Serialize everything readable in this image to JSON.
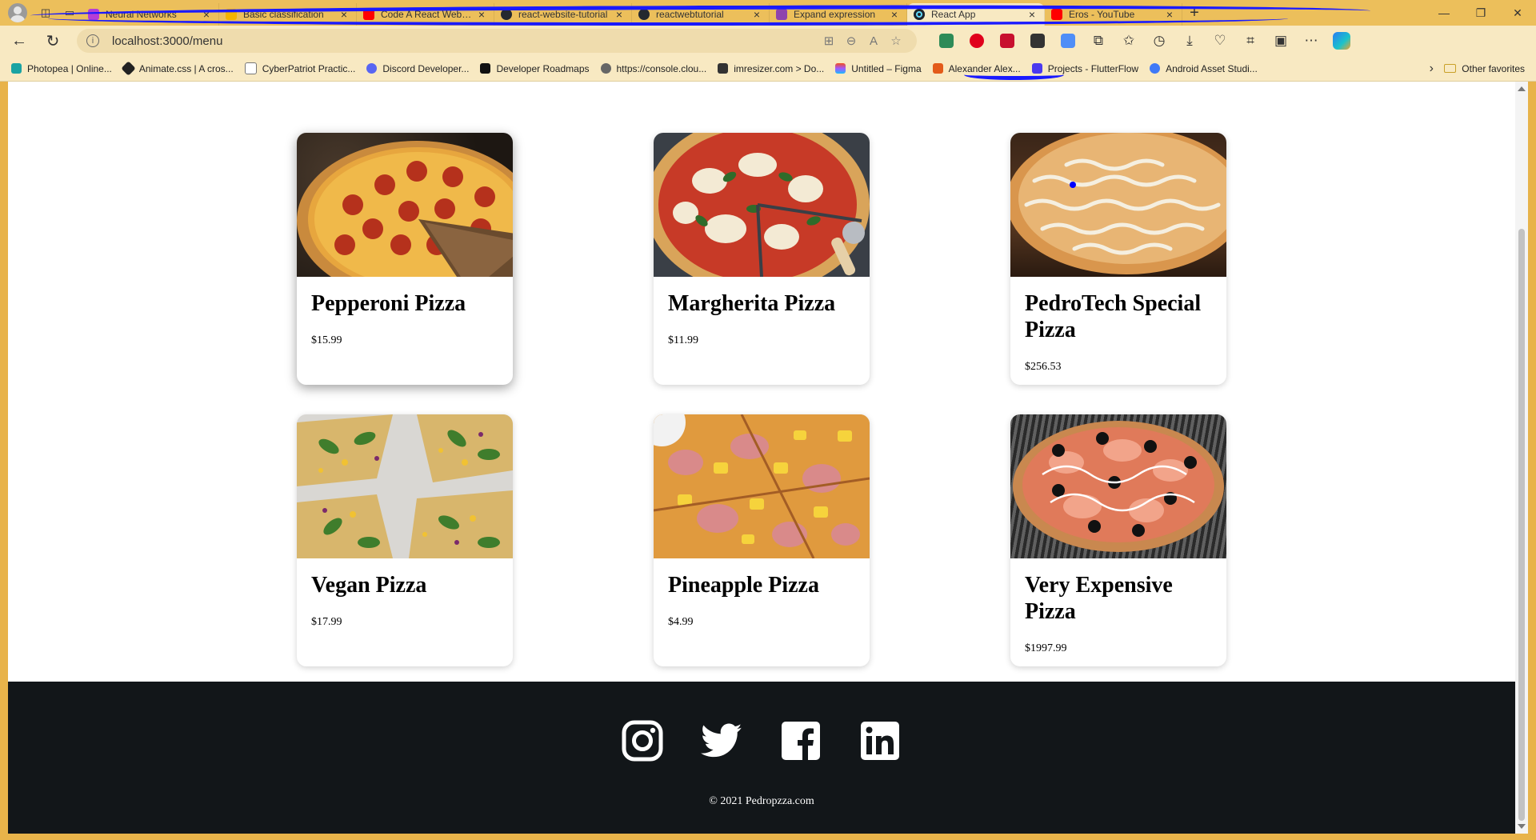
{
  "browser": {
    "tabs": [
      {
        "title": "Neural Networks",
        "favicon_color": "#b63dd6"
      },
      {
        "title": "Basic classification",
        "favicon_color": "#f4b400"
      },
      {
        "title": "Code A React Website",
        "favicon_color": "#ff0000"
      },
      {
        "title": "react-website-tutorial",
        "favicon_color": "#24292f"
      },
      {
        "title": "reactwebtutorial",
        "favicon_color": "#24292f"
      },
      {
        "title": "Expand expression",
        "favicon_color": "#8e44ad"
      },
      {
        "title": "React App",
        "favicon_color": "#20232a",
        "active": true
      },
      {
        "title": "Eros - YouTube",
        "favicon_color": "#ff0000"
      }
    ],
    "url": "localhost:3000/menu",
    "bookmarks": [
      {
        "label": "Photopea | Online...",
        "color": "#1aa3a3"
      },
      {
        "label": "Animate.css | A cros...",
        "color": "#222222"
      },
      {
        "label": "CyberPatriot Practic...",
        "color": "#777777"
      },
      {
        "label": "Discord Developer...",
        "color": "#5865f2"
      },
      {
        "label": "Developer Roadmaps",
        "color": "#111111"
      },
      {
        "label": "https://console.clou...",
        "color": "#666666"
      },
      {
        "label": "imresizer.com > Do...",
        "color": "#333333"
      },
      {
        "label": "Untitled – Figma",
        "color": "#f24e1e"
      },
      {
        "label": "Alexander Alex...",
        "color": "#e35b1a"
      },
      {
        "label": "Projects - FlutterFlow",
        "color": "#4b39ef"
      },
      {
        "label": "Android Asset Studi...",
        "color": "#3f79f7"
      }
    ],
    "other_favorites": "Other favorites"
  },
  "menu": {
    "items": [
      {
        "name": "Pepperoni Pizza",
        "price": "$15.99",
        "image": "pepperoni"
      },
      {
        "name": "Margherita Pizza",
        "price": "$11.99",
        "image": "margherita"
      },
      {
        "name": "PedroTech Special Pizza",
        "price": "$256.53",
        "image": "special"
      },
      {
        "name": "Vegan Pizza",
        "price": "$17.99",
        "image": "vegan"
      },
      {
        "name": "Pineapple Pizza",
        "price": "$4.99",
        "image": "pineapple"
      },
      {
        "name": "Very Expensive Pizza",
        "price": "$1997.99",
        "image": "expensive"
      }
    ]
  },
  "footer": {
    "social_icons": [
      "instagram-icon",
      "twitter-icon",
      "facebook-icon",
      "linkedin-icon"
    ],
    "copyright": "© 2021 Pedropzza.com"
  },
  "colors": {
    "footer_bg": "#121619",
    "browser_frame": "#ecbf5b",
    "toolbar": "#f8e9c2"
  }
}
